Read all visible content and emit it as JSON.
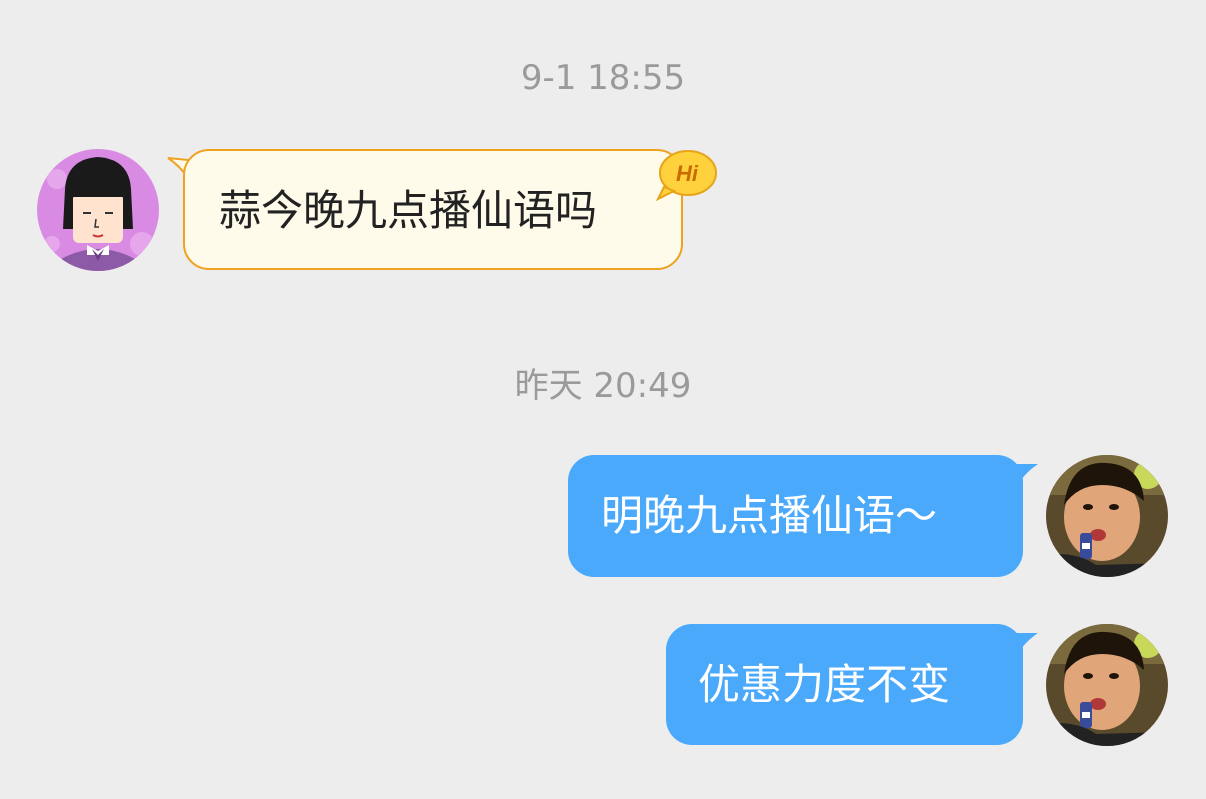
{
  "timestamps": [
    "9-1 18:55",
    "昨天 20:49"
  ],
  "messages": [
    {
      "direction": "incoming",
      "text": "蒜今晚九点播仙语吗",
      "badge": "Hi"
    },
    {
      "direction": "outgoing",
      "text": "明晚九点播仙语～"
    },
    {
      "direction": "outgoing",
      "text": "优惠力度不变"
    }
  ],
  "colors": {
    "background": "#ededed",
    "incoming_bubble": "#fffbea",
    "incoming_border": "#efa21f",
    "outgoing_bubble": "#4aa9fb",
    "timestamp_text": "#9a9a9a"
  },
  "icons": {
    "incoming_avatar": "cartoon-girl-avatar",
    "outgoing_avatar": "child-photo-avatar",
    "badge": "hi-speech-badge"
  }
}
